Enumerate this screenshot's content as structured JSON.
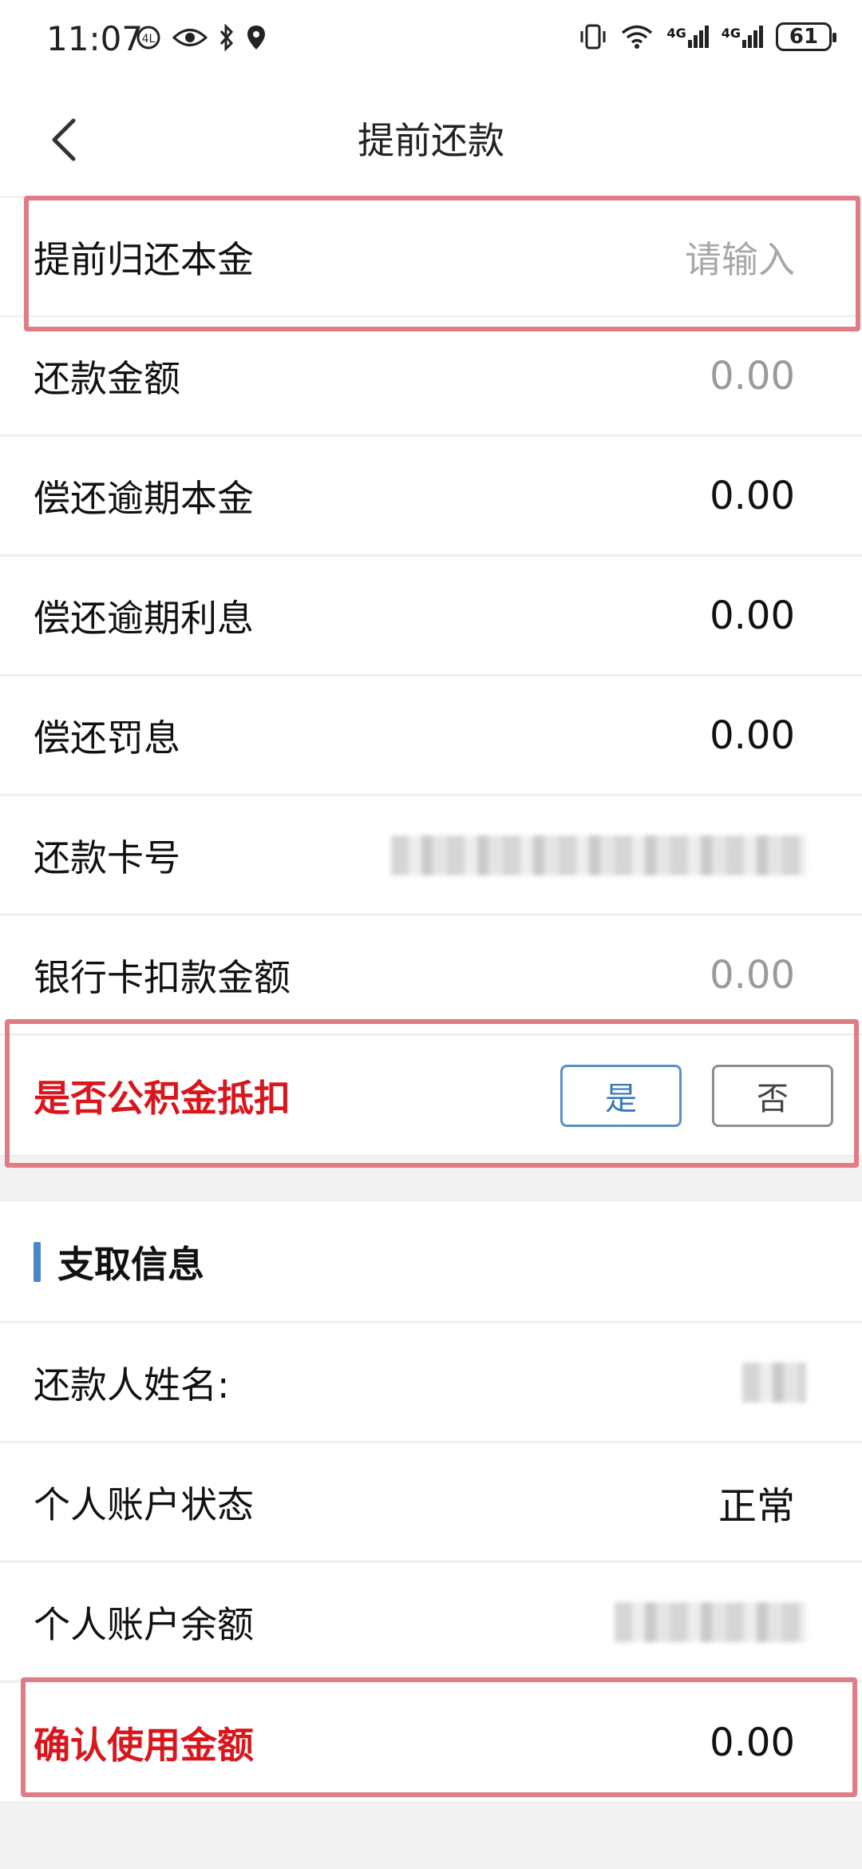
{
  "status_bar": {
    "time": "11:07",
    "battery": "61",
    "network_1": "4G",
    "network_2": "4G"
  },
  "header": {
    "title": "提前还款"
  },
  "repay_form": {
    "principal": {
      "label": "提前归还本金",
      "placeholder": "请输入"
    },
    "repay_amount": {
      "label": "还款金额",
      "value": "0.00"
    },
    "overdue_principal": {
      "label": "偿还逾期本金",
      "value": "0.00"
    },
    "overdue_interest": {
      "label": "偿还逾期利息",
      "value": "0.00"
    },
    "penalty_interest": {
      "label": "偿还罚息",
      "value": "0.00"
    },
    "card_number": {
      "label": "还款卡号"
    },
    "card_deduct_amount": {
      "label": "银行卡扣款金额",
      "value": "0.00"
    },
    "fund_deduct": {
      "label": "是否公积金抵扣",
      "yes": "是",
      "no": "否"
    }
  },
  "withdraw_info": {
    "section_title": "支取信息",
    "name": {
      "label": "还款人姓名:"
    },
    "account_status": {
      "label": "个人账户状态",
      "value": "正常"
    },
    "account_balance": {
      "label": "个人账户余额"
    },
    "confirm_amount": {
      "label": "确认使用金额",
      "value": "0.00"
    }
  },
  "colors": {
    "highlight": "#e07c86",
    "alert_red": "#d9161c",
    "accent_blue": "#4a86c8"
  }
}
